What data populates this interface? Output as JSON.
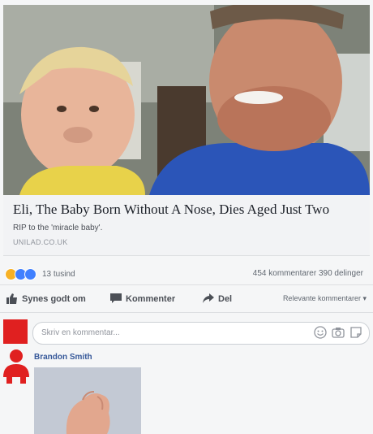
{
  "post": {
    "headline": "Eli, The Baby Born Without A Nose, Dies Aged Just Two",
    "subtitle": "RIP to the 'miracle baby'.",
    "source": "UNILAD.CO.UK"
  },
  "stats": {
    "reaction_count": "13 tusind",
    "comments_shares": "454 kommentarer  390 delinger"
  },
  "actions": {
    "like": "Synes godt om",
    "comment": "Kommenter",
    "share": "Del",
    "sort": "Relevante kommentarer ▾"
  },
  "composer": {
    "placeholder": "Skriv en kommentar..."
  },
  "comment": {
    "author": "Brandon Smith"
  },
  "colors": {
    "reaction_sad": "#f7b125",
    "reaction_like": "#4080ff",
    "author_link": "#365899",
    "avatar_red": "#e02020"
  },
  "icons": [
    "sad-reaction-icon",
    "like-reaction-icon",
    "thumbs-up-icon",
    "comment-icon",
    "share-icon",
    "emoji-icon",
    "camera-icon",
    "sticker-icon"
  ]
}
